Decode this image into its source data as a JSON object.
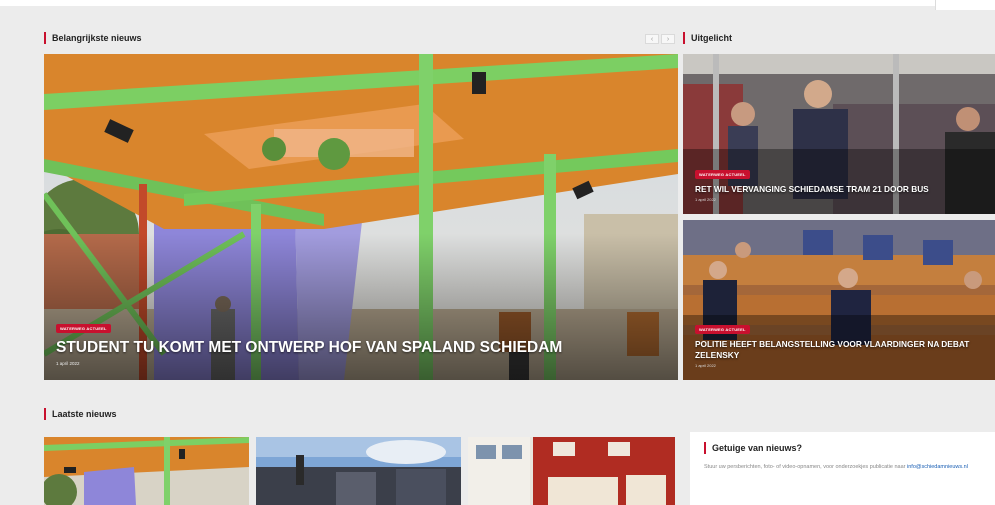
{
  "sections": {
    "main": "Belangrijkste nieuws",
    "featured": "Uitgelicht",
    "latest": "Laatste nieuws"
  },
  "carousel": {
    "prev": "‹",
    "next": "›"
  },
  "hero": {
    "tag": "WATERWEG ACTUEEL",
    "title": "STUDENT TU KOMT MET ONTWERP HOF VAN SPALAND SCHIEDAM",
    "date": "1 april 2022"
  },
  "featured_items": [
    {
      "tag": "WATERWEG ACTUEEL",
      "title": "RET WIL VERVANGING SCHIEDAMSE TRAM 21 DOOR BUS",
      "date": "1 april 2022"
    },
    {
      "tag": "WATERWEG ACTUEEL",
      "title": "POLITIE HEEFT BELANGSTELLING VOOR VLAARDINGER NA DEBAT ZELENSKY",
      "date": "1 april 2022"
    }
  ],
  "witness": {
    "title": "Getuige van nieuws?",
    "text": "Stuur uw persberichten, foto- of video-opnamen, voor onderzoekjes publicatie naar",
    "email": "info@schiedamnieuws.nl"
  },
  "colors": {
    "accent": "#c8102e",
    "background": "#ececec"
  }
}
